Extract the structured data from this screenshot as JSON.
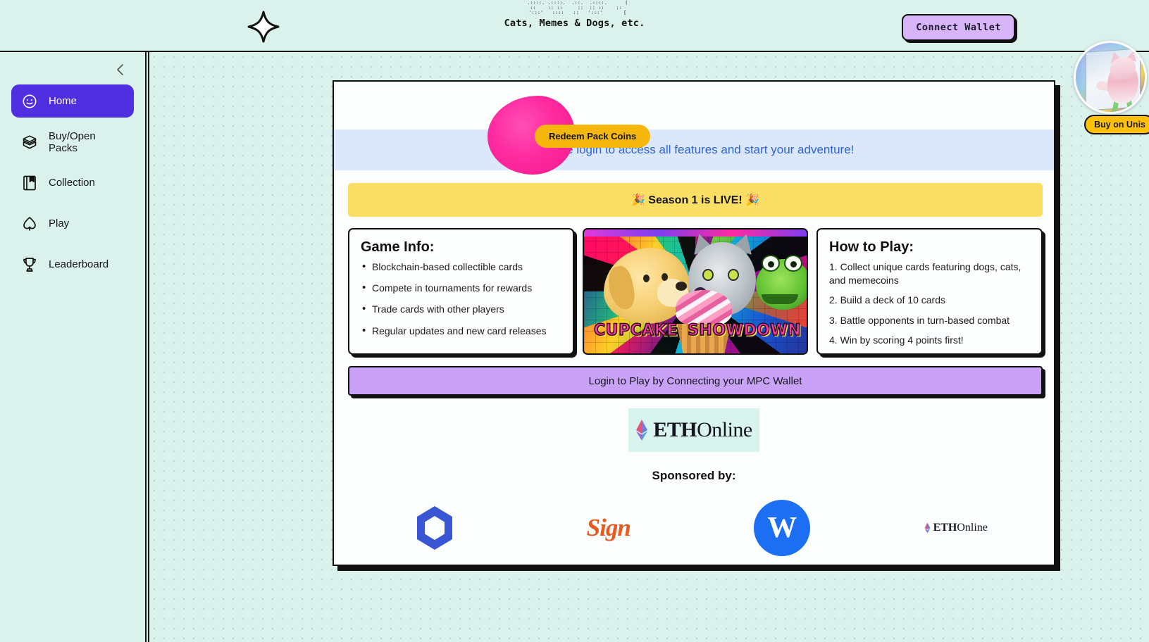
{
  "header": {
    "sparkle_icon": "sparkle-icon",
    "logo_lines": [
      "CATS (",
      "MEMES",
      "DOGS ("
    ],
    "logo_ascii_top": "  .::::. .::::.  .::.  .::::.      (",
    "logo_ascii_mid": " ::    :: ::     ::  :: ::    ::",
    "logo_ascii_bot": "  ':::'   ::::   ::   ':::'       [",
    "tagline": "Cats, Memes & Dogs, etc.",
    "connect_wallet_label": "Connect Wallet"
  },
  "avatar": {
    "name": "user-avatar",
    "buy_badge_label": "Buy on Unis"
  },
  "sidebar": {
    "collapse_label": "‹",
    "items": [
      {
        "label": "Home",
        "icon": "smiley-icon",
        "active": true
      },
      {
        "label": "Buy/Open Packs",
        "icon": "open-box-icon",
        "active": false
      },
      {
        "label": "Collection",
        "icon": "book-bookmark-icon",
        "active": false
      },
      {
        "label": "Play",
        "icon": "spade-icon",
        "active": false
      },
      {
        "label": "Leaderboard",
        "icon": "trophy-icon",
        "active": false
      }
    ]
  },
  "main": {
    "redeem_button_label": "Redeem Pack Coins",
    "login_banner": "Please login to access all features and start your adventure!",
    "season_banner": "🎉 Season 1 is LIVE! 🎉",
    "game_info": {
      "title": "Game Info:",
      "items": [
        "Blockchain-based collectible cards",
        "Compete in tournaments for rewards",
        "Trade cards with other players",
        "Regular updates and new card releases"
      ]
    },
    "hero_card": {
      "name": "cupcake-showdown-card",
      "title_left": "CUPCAKE",
      "title_right": "SHOWDOWN"
    },
    "how_to_play": {
      "title": "How to Play:",
      "steps": [
        "Collect unique cards featuring dogs, cats, and memecoins",
        "Build a deck of 10 cards",
        "Battle opponents in turn-based combat",
        "Win by scoring 4 points first!"
      ]
    },
    "login_cta_label": "Login to Play by Connecting your MPC Wallet",
    "eth_logo": {
      "bold": "ETH",
      "light": "Online"
    },
    "sponsored_title": "Sponsored by:",
    "sponsors": [
      {
        "name": "hexagon-sponsor-logo",
        "label": ""
      },
      {
        "name": "sign-sponsor-logo",
        "label": "Sign"
      },
      {
        "name": "w-sponsor-logo",
        "label": "W"
      },
      {
        "name": "ethonline-sponsor-logo",
        "label_bold": "ETH",
        "label_light": "Online"
      }
    ]
  },
  "colors": {
    "page_bg": "#daf1ec",
    "accent_purple": "#4f2fe0",
    "cta_purple": "#c9a2f7",
    "banner_yellow": "#fbdf64",
    "banner_blue": "#dbe7fb",
    "link_blue": "#2f63d6",
    "blob_pink": "#ff2aa0",
    "redeem_yellow": "#f5b70b",
    "badge_yellow": "#ffc107",
    "sponsor_blue": "#1c6ef2",
    "sign_orange": "#e8581f"
  }
}
